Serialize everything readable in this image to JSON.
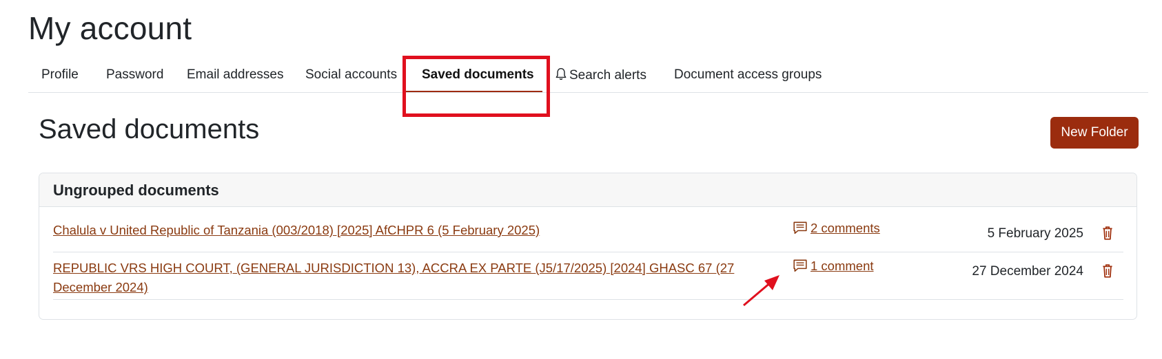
{
  "page": {
    "title": "My account"
  },
  "tabs": [
    {
      "label": "Profile"
    },
    {
      "label": "Password"
    },
    {
      "label": "Email addresses"
    },
    {
      "label": "Social accounts"
    },
    {
      "label": "Saved documents",
      "active": true
    },
    {
      "label": "Search alerts",
      "icon": "bell-icon"
    },
    {
      "label": "Document access groups"
    }
  ],
  "section": {
    "title": "Saved documents",
    "new_folder_label": "New Folder"
  },
  "group": {
    "title": "Ungrouped documents",
    "documents": [
      {
        "title": "Chalula v United Republic of Tanzania (003/2018) [2025] AfCHPR 6 (5 February 2025)",
        "comments": "2 comments",
        "date": "5 February 2025"
      },
      {
        "title": "REPUBLIC VRS HIGH COURT, (GENERAL JURISDICTION 13), ACCRA EX PARTE (J5/17/2025) [2024] GHASC 67 (27 December 2024)",
        "comments": "1 comment",
        "date": "27 December 2024"
      }
    ]
  },
  "colors": {
    "accent": "#9b2c0e",
    "link": "#8a3a10",
    "annotation": "#e0101e"
  }
}
